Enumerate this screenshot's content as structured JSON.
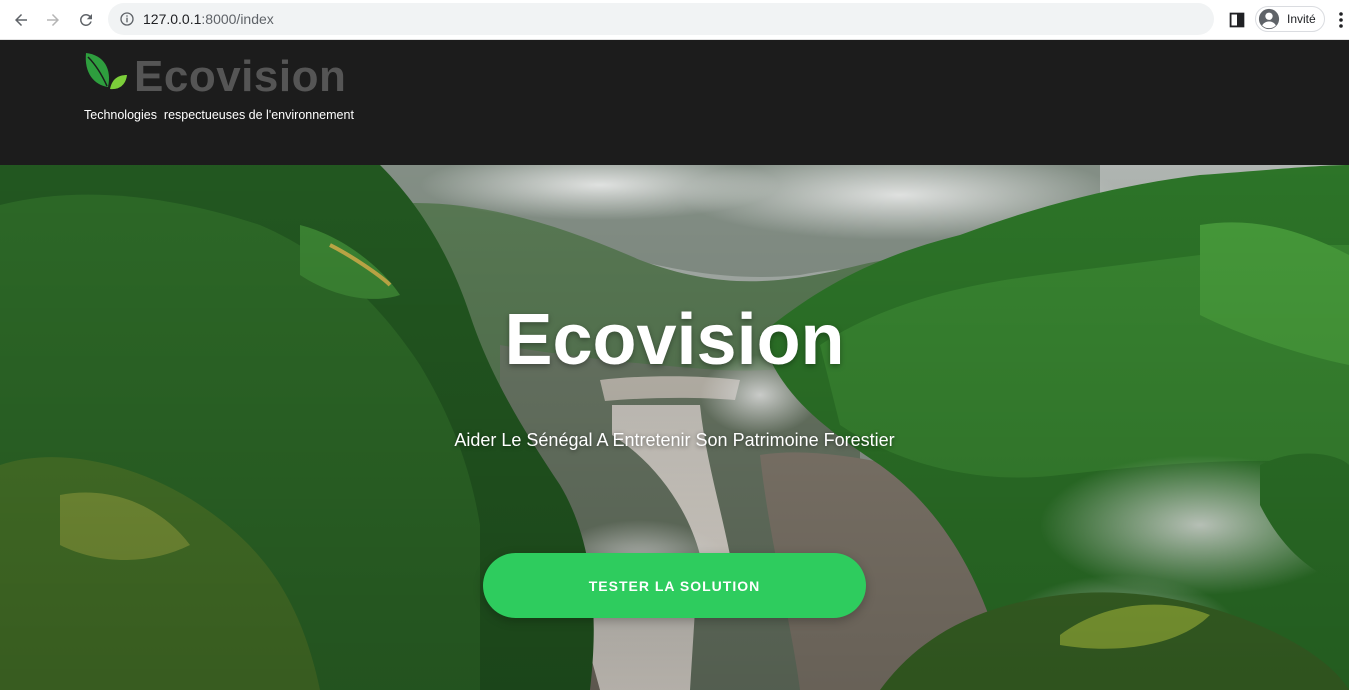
{
  "browser": {
    "url_host": "127.0.0.1",
    "url_path": ":8000/index",
    "profile_label": "Invité"
  },
  "header": {
    "logo_text": "Ecovision",
    "tagline": "Technologies  respectueuses de l'environnement"
  },
  "hero": {
    "title": "Ecovision",
    "subtitle": "Aider Le Sénégal A Entretenir Son Patrimoine Forestier",
    "cta_label": "TESTER LA SOLUTION"
  },
  "colors": {
    "header_bg": "#1c1c1c",
    "logo_text": "#555555",
    "leaf_dark": "#2e9e3e",
    "leaf_light": "#7ccf3a",
    "cta_bg": "#2ecc5e",
    "forest_green": "#2f7a2a"
  },
  "icons": [
    "back-arrow-icon",
    "forward-arrow-icon",
    "reload-icon",
    "info-icon",
    "side-panel-icon",
    "profile-icon",
    "kebab-menu-icon",
    "leaf-logo-icon"
  ]
}
